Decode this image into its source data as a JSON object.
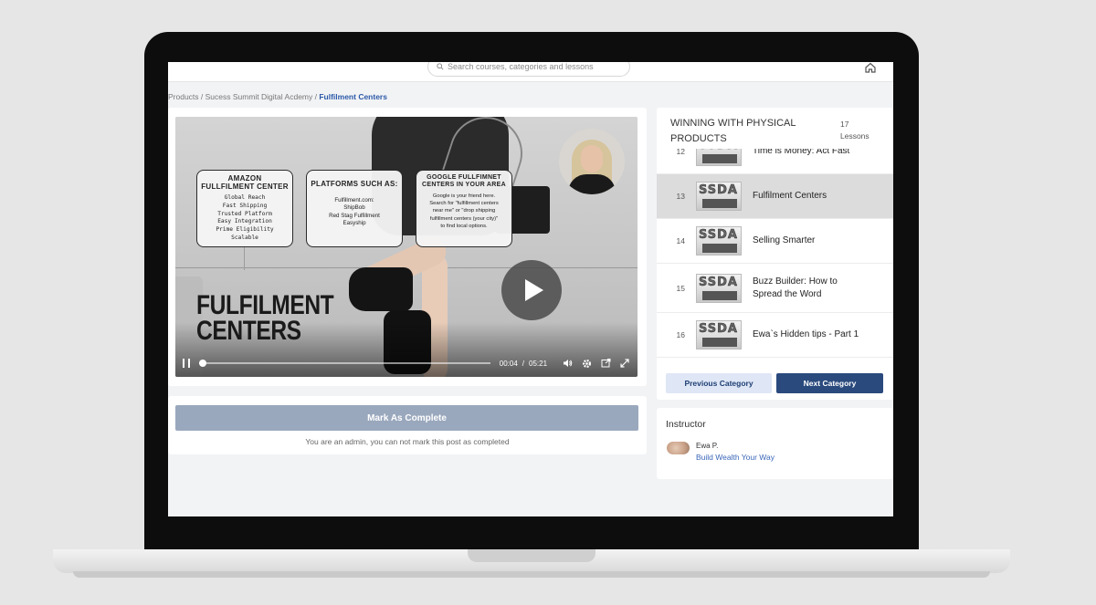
{
  "search": {
    "placeholder": "Search courses, categories and lessons"
  },
  "breadcrumb": {
    "trail": "Products / Sucess Summit Digital Acdemy / ",
    "current": "Fulfilment Centers"
  },
  "video": {
    "boxes": [
      {
        "title": "AMAZON FULLFILMENT CENTER",
        "text": "Global Reach\nFast Shipping\nTrusted Platform\nEasy Integration\nPrime Eligibility\nScalable"
      },
      {
        "title": "PLATFORMS SUCH AS:",
        "text": "Fulfillment.com:\nShipBob\nRed Stag Fulfillment\nEasyship"
      },
      {
        "title": "GOOGLE FULLFIMNET CENTERS IN YOUR AREA",
        "text": "Google is your friend here.\nSearch for \"fulfillment centers\nnear me\" or \"drop shipping\nfulfillment centers (your city)\"\nto find local options."
      }
    ],
    "overlay_title": "FULFILMENT\nCENTERS",
    "current_time": "00:04",
    "time_separator": "/",
    "duration": "05:21",
    "progress_fraction": 0.0125
  },
  "mark_complete": {
    "button_label": "Mark As Complete",
    "note": "You are an admin, you can not mark this post as completed"
  },
  "course_panel": {
    "title": "WINNING WITH PHYSICAL PRODUCTS",
    "lesson_count": "17",
    "lesson_count_label": "Lessons",
    "partial_lesson": {
      "num": "12",
      "name": "Time is Money: Act Fast"
    },
    "lessons": [
      {
        "num": "13",
        "name": "Fulfilment Centers",
        "active": true
      },
      {
        "num": "14",
        "name": "Selling Smarter",
        "active": false
      },
      {
        "num": "15",
        "name": "Buzz Builder: How to Spread the Word",
        "active": false
      },
      {
        "num": "16",
        "name": "Ewa`s Hidden tips - Part 1",
        "active": false
      }
    ],
    "thumb_text": "SSDA",
    "prev_label": "Previous Category",
    "next_label": "Next Category"
  },
  "instructor": {
    "heading": "Instructor",
    "name": "Ewa P.",
    "link": "Build Wealth Your Way"
  },
  "colors": {
    "accent": "#2a4a7d",
    "link": "#3a66b8",
    "mark_button": "#9aa8bd",
    "active_lesson": "#dcdcdc"
  },
  "icons": [
    "search-icon",
    "home-icon",
    "pause-icon",
    "volume-icon",
    "settings-icon",
    "pip-icon",
    "fullscreen-icon",
    "play-icon"
  ]
}
